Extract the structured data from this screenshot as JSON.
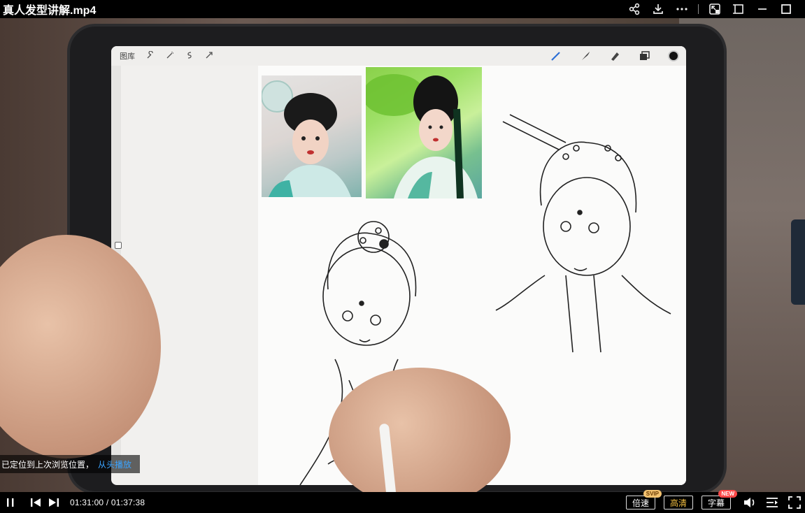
{
  "window": {
    "title": "真人发型讲解.mp4",
    "icons": [
      "share-icon",
      "download-icon",
      "more-icon",
      "picture-in-picture-icon",
      "mini-window-icon",
      "minimize-icon",
      "maximize-icon"
    ]
  },
  "procreate": {
    "gallery_label": "图库",
    "tools_left": [
      "wrench-icon",
      "magic-wand-icon",
      "selection-icon",
      "transform-icon"
    ],
    "tools_right": [
      "brush-icon",
      "smudge-icon",
      "eraser-icon",
      "layers-icon",
      "color-icon"
    ]
  },
  "hint": {
    "text": "已定位到上次浏览位置，",
    "link": "从头播放"
  },
  "player": {
    "current_time": "01:31:00",
    "separator": " / ",
    "total_time": "01:37:38",
    "progress": 0.957,
    "speed_label": "倍速",
    "speed_badge": "SVIP",
    "quality_label": "高清",
    "subtitle_label": "字幕",
    "subtitle_badge": "NEW"
  },
  "colors": {
    "progress": "#2a9df4",
    "quality_active": "#f5c142",
    "link": "#3aa3ff"
  }
}
